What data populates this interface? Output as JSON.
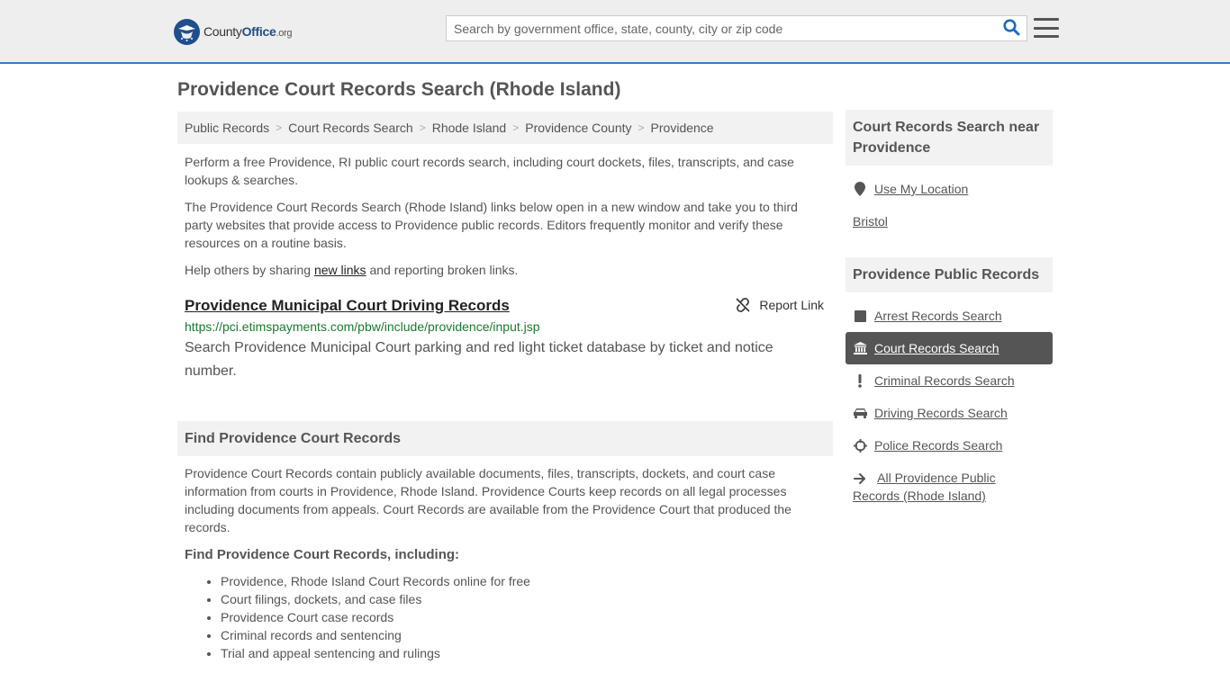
{
  "header": {
    "logo": {
      "county": "County",
      "office": "Office",
      "org": ".org"
    },
    "search": {
      "placeholder": "Search by government office, state, county, city or zip code"
    }
  },
  "page": {
    "title": "Providence Court Records Search (Rhode Island)"
  },
  "breadcrumb": [
    {
      "label": "Public Records"
    },
    {
      "label": "Court Records Search"
    },
    {
      "label": "Rhode Island"
    },
    {
      "label": "Providence County"
    },
    {
      "label": "Providence"
    }
  ],
  "intro": {
    "p1": "Perform a free Providence, RI public court records search, including court dockets, files, transcripts, and case lookups & searches.",
    "p2": "The Providence Court Records Search (Rhode Island) links below open in a new window and take you to third party websites that provide access to Providence public records. Editors frequently monitor and verify these resources on a routine basis.",
    "p3_before": "Help others by sharing ",
    "p3_link": "new links",
    "p3_after": " and reporting broken links."
  },
  "listing": {
    "title": "Providence Municipal Court Driving Records",
    "report_label": "Report Link",
    "url": "https://pci.etimspayments.com/pbw/include/providence/input.jsp",
    "description": "Search Providence Municipal Court parking and red light ticket database by ticket and notice number."
  },
  "find_section": {
    "header": "Find Providence Court Records",
    "body": "Providence Court Records contain publicly available documents, files, transcripts, dockets, and court case information from courts in Providence, Rhode Island. Providence Courts keep records on all legal processes including documents from appeals. Court Records are available from the Providence Court that produced the records.",
    "subheading": "Find Providence Court Records, including:",
    "items": [
      "Providence, Rhode Island Court Records online for free",
      "Court filings, dockets, and case files",
      "Providence Court case records",
      "Criminal records and sentencing",
      "Trial and appeal sentencing and rulings"
    ]
  },
  "sidebar": {
    "near": {
      "header": "Court Records Search near Providence",
      "use_location": "Use My Location",
      "nearby": "Bristol"
    },
    "public_records": {
      "header": "Providence Public Records",
      "items": [
        {
          "label": "Arrest Records Search",
          "icon": "square-icon"
        },
        {
          "label": "Court Records Search",
          "icon": "courthouse-icon"
        },
        {
          "label": "Criminal Records Search",
          "icon": "exclamation-icon"
        },
        {
          "label": "Driving Records Search",
          "icon": "car-icon"
        },
        {
          "label": "Police Records Search",
          "icon": "crosshair-icon"
        },
        {
          "label": "All Providence Public Records (Rhode Island)",
          "icon": "arrow-right-icon"
        }
      ],
      "active_index": 1
    }
  },
  "colors": {
    "accent": "#3a7bbf",
    "brand": "#1f4e8c",
    "url_green": "#1a7a2e",
    "active_bg": "#555555"
  }
}
